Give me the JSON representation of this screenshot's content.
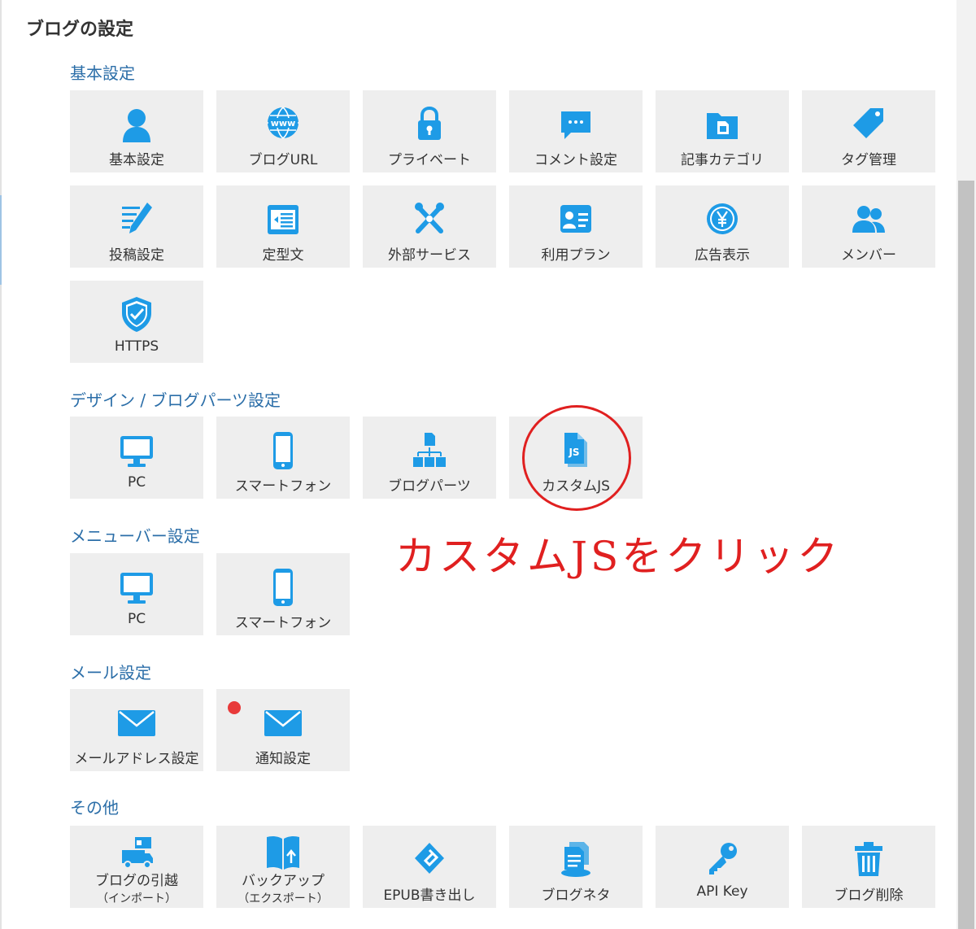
{
  "page_title": "ブログの設定",
  "colors": {
    "icon": "#1e9be6",
    "tile_bg": "#eeeeee",
    "section_title": "#2b6ea8",
    "annotation": "#e02020"
  },
  "sections": [
    {
      "title": "基本設定",
      "tiles": [
        {
          "label": "基本設定",
          "icon": "user-icon"
        },
        {
          "label": "ブログURL",
          "icon": "www-globe-icon"
        },
        {
          "label": "プライベート",
          "icon": "lock-icon"
        },
        {
          "label": "コメント設定",
          "icon": "comment-icon"
        },
        {
          "label": "記事カテゴリ",
          "icon": "folder-icon"
        },
        {
          "label": "タグ管理",
          "icon": "tag-icon"
        },
        {
          "label": "投稿設定",
          "icon": "pencil-icon"
        },
        {
          "label": "定型文",
          "icon": "template-icon"
        },
        {
          "label": "外部サービス",
          "icon": "tools-icon"
        },
        {
          "label": "利用プラン",
          "icon": "id-card-icon"
        },
        {
          "label": "広告表示",
          "icon": "yen-icon"
        },
        {
          "label": "メンバー",
          "icon": "users-icon"
        },
        {
          "label": "HTTPS",
          "icon": "shield-check-icon"
        }
      ]
    },
    {
      "title": "デザイン / ブログパーツ設定",
      "tiles": [
        {
          "label": "PC",
          "icon": "monitor-icon"
        },
        {
          "label": "スマートフォン",
          "icon": "smartphone-icon"
        },
        {
          "label": "ブログパーツ",
          "icon": "blog-parts-icon"
        },
        {
          "label": "カスタムJS",
          "icon": "js-file-icon"
        }
      ]
    },
    {
      "title": "メニューバー設定",
      "tiles": [
        {
          "label": "PC",
          "icon": "monitor-icon"
        },
        {
          "label": "スマートフォン",
          "icon": "smartphone-icon"
        }
      ]
    },
    {
      "title": "メール設定",
      "tiles": [
        {
          "label": "メールアドレス設定",
          "icon": "mail-icon"
        },
        {
          "label": "通知設定",
          "icon": "mail-notification-icon"
        }
      ]
    },
    {
      "title": "その他",
      "tiles": [
        {
          "label": "ブログの引越",
          "sub": "（インポート）",
          "icon": "truck-icon"
        },
        {
          "label": "バックアップ",
          "sub": "（エクスポート）",
          "icon": "book-upload-icon"
        },
        {
          "label": "EPUB書き出し",
          "icon": "epub-icon"
        },
        {
          "label": "ブログネタ",
          "icon": "documents-icon"
        },
        {
          "label": "API Key",
          "icon": "key-icon"
        },
        {
          "label": "ブログ削除",
          "icon": "trash-icon"
        }
      ]
    }
  ],
  "annotation": {
    "text": "カスタムJSをクリック"
  }
}
